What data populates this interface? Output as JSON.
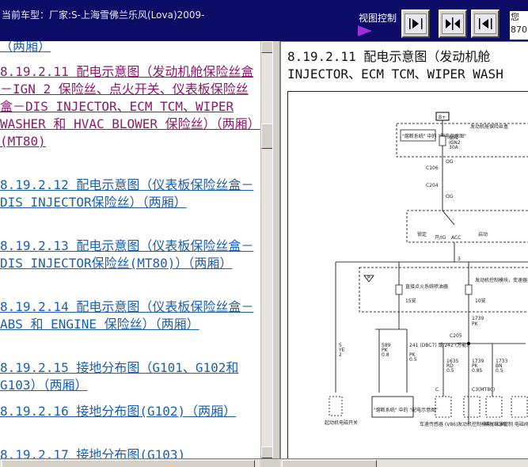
{
  "header": {
    "car_model": "当前车型：厂家:S-上海雪佛兰乐风(Lova)2009-",
    "view_control_label": "视图控制",
    "right_tag_line1": "您",
    "right_tag_line2": "870"
  },
  "toc": {
    "items": [
      {
        "id": "prev-tail",
        "text": "（两厢）"
      },
      {
        "id": "8.19.2.11",
        "text": "  8.19.2.11 配电示意图（发动机舱保险丝盒－IGN 2 保险丝、点火开关、仪表板保险丝盒－DIS INJECTOR、ECM TCM、WIPER WASHER 和 HVAC BLOWER 保险丝）（两厢）(MT80)"
      },
      {
        "id": "8.19.2.12",
        "text": "  8.19.2.12 配电示意图（仪表板保险丝盒－DIS INJECTOR保险丝）（两厢）"
      },
      {
        "id": "8.19.2.13",
        "text": "  8.19.2.13 配电示意图（仪表板保险丝盒－DIS INJECTOR保险丝(MT80)）（两厢）"
      },
      {
        "id": "8.19.2.14",
        "text": "  8.19.2.14 配电示意图（仪表板保险丝盒－ABS 和 ENGINE 保险丝）（两厢）"
      },
      {
        "id": "8.19.2.15",
        "text": "  8.19.2.15 接地分布图（G101、G102和G103）（两厢）"
      },
      {
        "id": "8.19.2.16",
        "text": "  8.19.2.16 接地分布图(G102)（两厢）"
      },
      {
        "id": "8.19.2.17",
        "text": "  8.19.2.17 接地分布图(G103)"
      }
    ]
  },
  "content": {
    "title_line1": "8.19.2.11 配电示意图（发动机舱",
    "title_line2": "INJECTOR、ECM TCM、WIPER WASH"
  },
  "diagram": {
    "labels": {
      "bplus": "B+",
      "engine_fuse_box": "发动机舱保险丝盒",
      "fuse_detail": "\"熔断系统\" 中的 \"配电示意图\"",
      "fuse_ign2_1": "保险",
      "fuse_ign2_2": "IGN2",
      "fuse_ign2_3": "30A",
      "og1": "OG",
      "c106": "C106",
      "c204": "C204",
      "og2": "OG",
      "lock": "锁定",
      "on_off": "开/IG",
      "acc": "ACC",
      "start": "启动",
      "three": "3",
      "dis_fuse": "直接点火系统喷油器",
      "dis_fuse_amp": "15安",
      "ecm_fuse": "发动机控制模块，变速器控制模块",
      "ecm_fuse_amp": "10安",
      "w1739": "1739",
      "pk": "PK",
      "c205": "C205",
      "w589": "589",
      "w589c": "PK",
      "w589s": "0.8",
      "w241": "241 (DBC7) 或 242 (万能)",
      "w241c": "PK",
      "w241s": "0.5",
      "w5": "5",
      "ye": "YE",
      "two": "2",
      "w1635": "1635",
      "rd": "RD",
      "w05": "0.5",
      "w1739b": "1739",
      "pk2": "PK",
      "w085": "0.85",
      "w1733": "1733",
      "bn": "BN",
      "w05b": "0.5",
      "c3": "C3(MT80)",
      "c_lbl": "C",
      "neg_lbl": "\"熔断系统\" 中的 \"配电示意图\"",
      "starter_relay": "起动机电磁开关",
      "speed_sensor": "车速传感器 (V86)",
      "ecm_lbl": "发动机控制模块 (ECM)",
      "evap_lbl": "蒸发排放管制 电磁阀",
      "ptr": "P"
    }
  }
}
